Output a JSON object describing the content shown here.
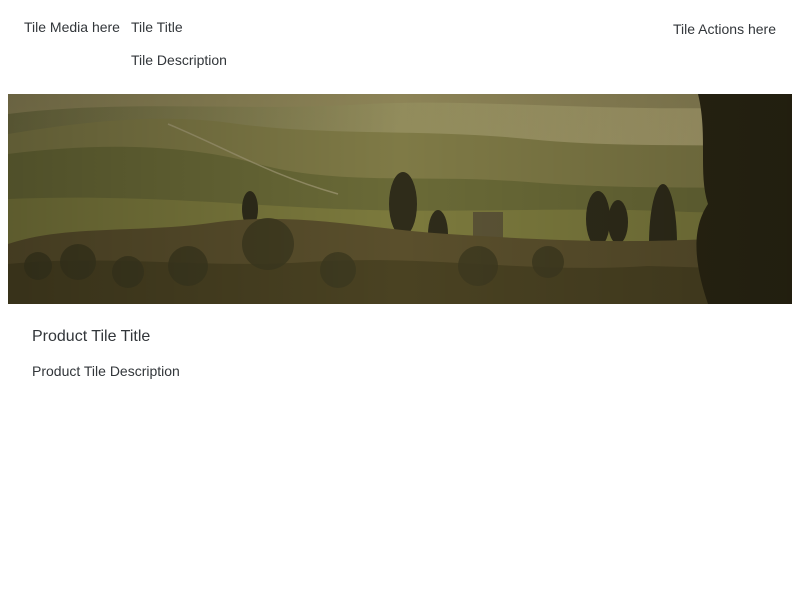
{
  "tile": {
    "media_label": "Tile Media here",
    "title": "Tile Title",
    "description": "Tile Description",
    "actions_label": "Tile Actions here"
  },
  "product": {
    "title": "Product Tile Title",
    "description": "Product Tile Description"
  },
  "colors": {
    "text": "#32363a",
    "background": "#ffffff"
  }
}
